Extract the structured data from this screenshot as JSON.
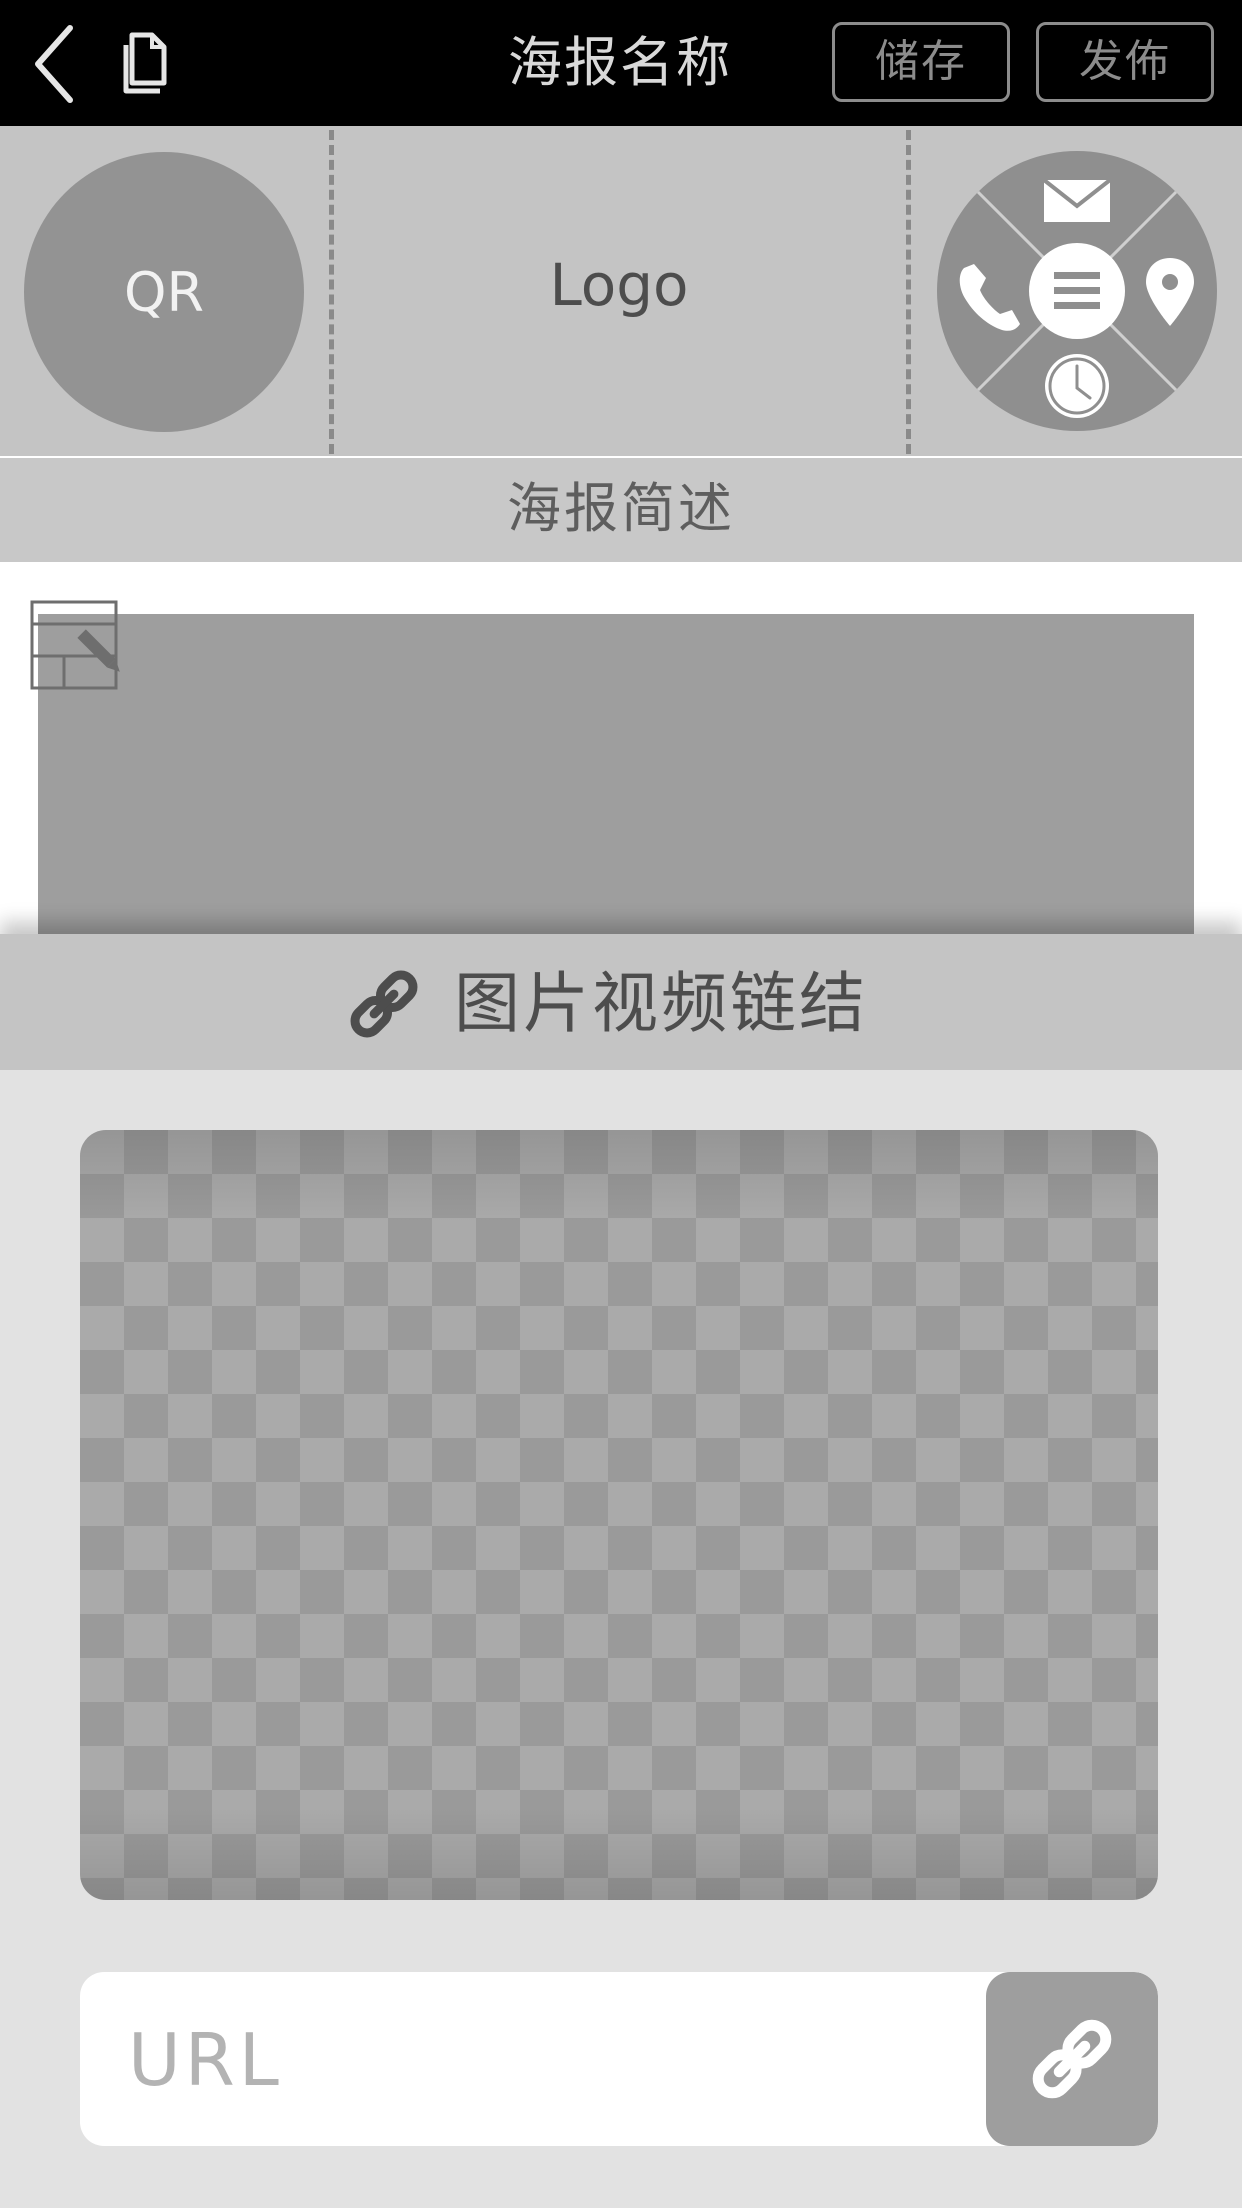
{
  "topbar": {
    "title": "海报名称",
    "save_label": "储存",
    "publish_label": "发佈",
    "back_icon": "chevron-left-icon",
    "document_icon": "document-icon"
  },
  "header": {
    "qr_label": "QR",
    "logo_label": "Logo",
    "contact_icons": [
      "mail-icon",
      "phone-icon",
      "location-icon",
      "clock-icon",
      "menu-icon"
    ]
  },
  "description": {
    "label": "海报简述"
  },
  "link_panel": {
    "title": "图片视频链结",
    "url_placeholder": "URL",
    "url_value": ""
  },
  "colors": {
    "topbar": "#000000",
    "header_band": "#c4c4c4",
    "panel_background": "#e2e2e2",
    "accent_gray": "#9e9e9e"
  }
}
